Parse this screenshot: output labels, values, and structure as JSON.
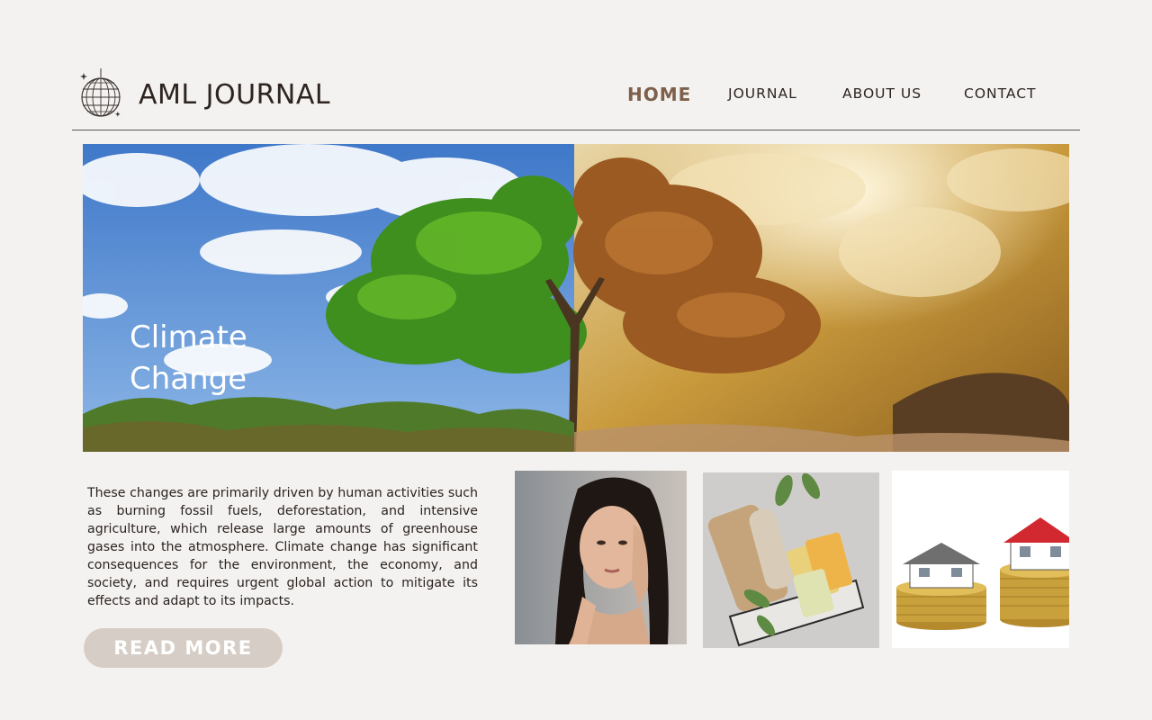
{
  "brand": {
    "name": "AML JOURNAL",
    "logo_icon": "disco-ball-icon"
  },
  "nav": {
    "items": [
      {
        "label": "HOME",
        "active": true
      },
      {
        "label": "JOURNAL",
        "active": false
      },
      {
        "label": "ABOUT US",
        "active": false
      },
      {
        "label": "CONTACT",
        "active": false
      }
    ],
    "active_color": "#7d5f4a"
  },
  "hero": {
    "title_line1": "Climate",
    "title_line2": "Change",
    "image": "tree-half-green-half-autumn"
  },
  "article": {
    "text": "These changes are primarily driven by human activities such as burning fossil fuels, deforestation, and intensive agriculture, which release large amounts of greenhouse gases into the atmosphere. Climate change has significant consequences for the environment, the economy, and society, and requires urgent global action to mitigate its effects and adapt to its impacts.",
    "button_label": "READ MORE",
    "button_color": "#d6cdc6"
  },
  "thumbnails": [
    {
      "subject": "woman-skincare-photo"
    },
    {
      "subject": "soap-and-brush-photo"
    },
    {
      "subject": "houses-on-coins-photo"
    }
  ],
  "colors": {
    "background": "#f4f2f0",
    "text": "#2d2420",
    "rule": "#5a5450"
  }
}
